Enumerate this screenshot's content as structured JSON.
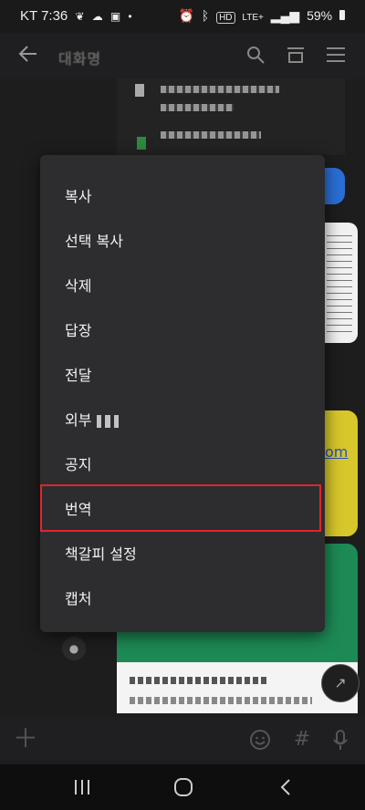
{
  "status_bar": {
    "carrier": "KT",
    "time": "7:36",
    "network": "LTE+",
    "battery": "59%"
  },
  "header": {
    "chat_title": "대화명"
  },
  "context_menu": {
    "items": [
      {
        "label": "복사"
      },
      {
        "label": "선택 복사"
      },
      {
        "label": "삭제"
      },
      {
        "label": "답장"
      },
      {
        "label": "전달"
      },
      {
        "label": "외부"
      },
      {
        "label": "공지"
      },
      {
        "label": "번역"
      },
      {
        "label": "책갈피 설정"
      },
      {
        "label": "캡처"
      }
    ],
    "highlighted_item": "번역",
    "highlight_color": "#e0252b"
  },
  "chat": {
    "partial_link_text": "om"
  },
  "colors": {
    "kakao_yellow": "#d8c72a",
    "accent_blue": "#2a6fd6",
    "accent_green": "#1d8a55"
  }
}
